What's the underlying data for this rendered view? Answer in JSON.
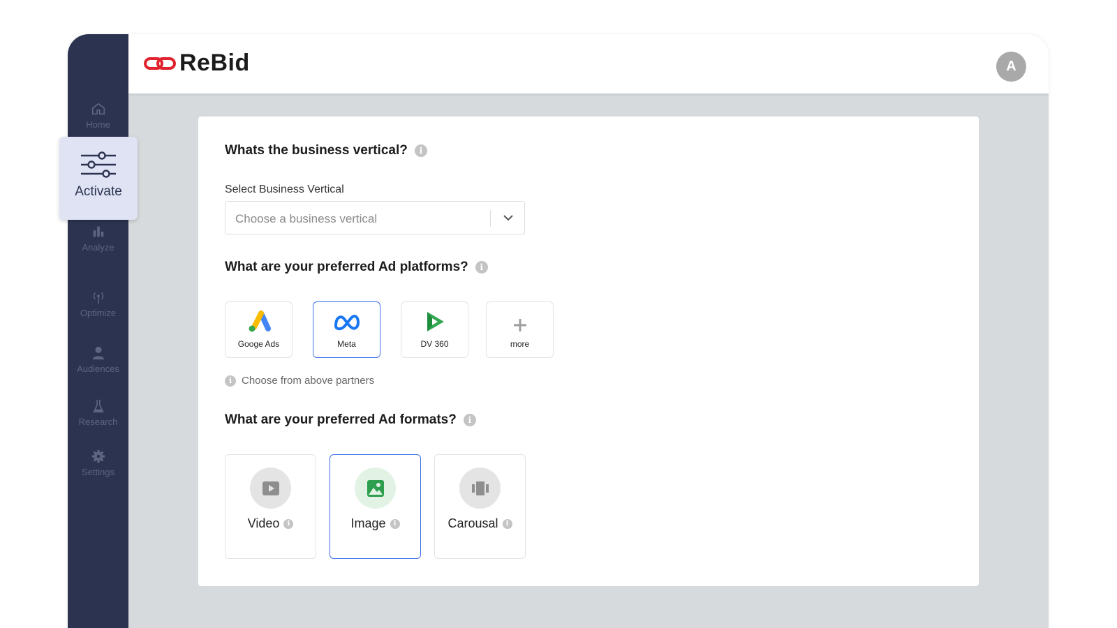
{
  "brand": {
    "name": "ReBid",
    "accent": "#e0242f"
  },
  "user": {
    "avatar_letter": "A"
  },
  "sidebar": {
    "items": [
      {
        "label": "Home",
        "icon": "home-icon"
      },
      {
        "label": "Activate",
        "icon": "sliders-icon",
        "active": true
      },
      {
        "label": "Analyze",
        "icon": "bar-chart-icon"
      },
      {
        "label": "Optimize",
        "icon": "broadcast-icon"
      },
      {
        "label": "Audiences",
        "icon": "person-icon"
      },
      {
        "label": "Research",
        "icon": "flask-icon"
      },
      {
        "label": "Settings",
        "icon": "gear-icon"
      }
    ]
  },
  "vertical": {
    "question": "Whats the business vertical?",
    "field_label": "Select Business Vertical",
    "placeholder": "Choose a business vertical"
  },
  "platforms": {
    "question": "What are your preferred Ad platforms?",
    "items": [
      {
        "label": "Googe Ads",
        "icon": "google-ads-icon",
        "selected": false
      },
      {
        "label": "Meta",
        "icon": "meta-icon",
        "selected": true
      },
      {
        "label": "DV 360",
        "icon": "dv360-icon",
        "selected": false
      },
      {
        "label": "more",
        "icon": "plus-icon",
        "selected": false
      }
    ],
    "hint": "Choose from above partners"
  },
  "formats": {
    "question": "What are your preferred Ad formats?",
    "items": [
      {
        "label": "Video",
        "icon": "video-icon",
        "selected": false
      },
      {
        "label": "Image",
        "icon": "image-icon",
        "selected": true
      },
      {
        "label": "Carousal",
        "icon": "carousel-icon",
        "selected": false
      }
    ]
  },
  "colors": {
    "sidebar_bg": "#2b3350",
    "selected_border": "#3a6fe8",
    "active_pill": "#dfe3f4"
  }
}
